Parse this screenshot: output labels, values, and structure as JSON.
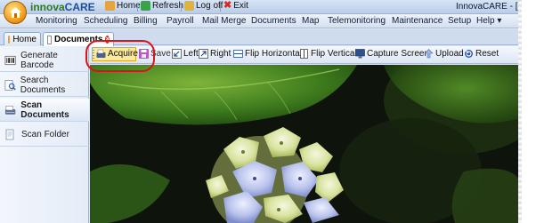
{
  "app": {
    "brand_prefix": "innova",
    "brand_suffix": "CARE",
    "window_title": "InnovaCARE - [Doc"
  },
  "quick_access": [
    {
      "label": "Home",
      "icon": "home-icon"
    },
    {
      "label": "Refresh",
      "icon": "refresh-icon"
    },
    {
      "label": "Log off",
      "icon": "logoff-icon"
    },
    {
      "label": "Exit",
      "icon": "exit-icon"
    }
  ],
  "menu": [
    "Monitoring",
    "Scheduling",
    "Billing",
    "Payroll",
    "Mail Merge",
    "Documents",
    "Map",
    "Telemonitoring",
    "Maintenance",
    "Setup",
    "Help ▾"
  ],
  "tabs": [
    {
      "label": "Home",
      "icon": "home-icon"
    },
    {
      "label": "Documents",
      "icon": "document-icon",
      "active": true
    }
  ],
  "sidebar": [
    {
      "label": "Generate Barcode",
      "icon": "barcode-icon"
    },
    {
      "label": "Search Documents",
      "icon": "search-document-icon"
    },
    {
      "label": "Scan Documents",
      "icon": "scanner-icon",
      "active": true
    },
    {
      "label": "Scan Folder",
      "icon": "folder-icon"
    }
  ],
  "toolbar": [
    {
      "label": "Acquire",
      "icon": "scanner-icon"
    },
    {
      "label": "Save",
      "icon": "save-icon"
    },
    {
      "label": "Left",
      "icon": "rotate-left-icon"
    },
    {
      "label": "Right",
      "icon": "rotate-right-icon"
    },
    {
      "label": "Flip Horizontal",
      "icon": "flip-horizontal-icon"
    },
    {
      "label": "Flip Vertical",
      "icon": "flip-vertical-icon"
    },
    {
      "label": "Capture Screen",
      "icon": "monitor-icon"
    },
    {
      "label": "Upload",
      "icon": "upload-icon"
    },
    {
      "label": "Reset",
      "icon": "reset-icon"
    }
  ],
  "colors": {
    "highlight": "#d6141c",
    "brand_green": "#2d7a1f",
    "brand_blue": "#1f4e9c"
  }
}
